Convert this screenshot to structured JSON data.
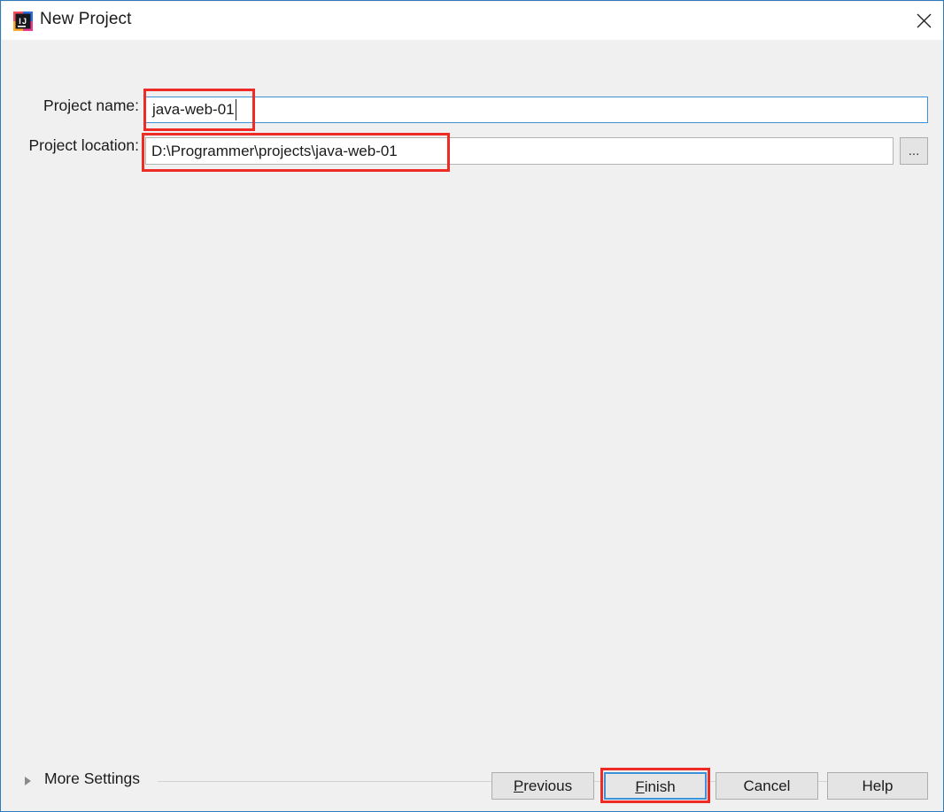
{
  "window": {
    "title": "New Project",
    "icon": "intellij-idea-icon",
    "close_icon": "close-icon"
  },
  "form": {
    "project_name": {
      "label": "Project name:",
      "value": "java-web-01",
      "placeholder": "",
      "focused": true
    },
    "project_location": {
      "label": "Project location:",
      "value": "D:\\Programmer\\projects\\java-web-01",
      "placeholder": "",
      "browse_label": "..."
    }
  },
  "more_settings": {
    "label": "More Settings",
    "expanded": false,
    "arrow_icon": "chevron-right-icon"
  },
  "buttons": {
    "previous": {
      "label": "Previous",
      "mnemonic": "P"
    },
    "finish": {
      "label": "Finish",
      "mnemonic": "F",
      "focused": true
    },
    "cancel": {
      "label": "Cancel"
    },
    "help": {
      "label": "Help"
    }
  },
  "annotations": {
    "color": "#ee2b24",
    "targets": [
      "project-name-value",
      "project-location-value",
      "finish-button"
    ]
  },
  "colors": {
    "window_border": "#2f7bbd",
    "panel_background": "#f0f0f0",
    "titlebar_background": "#ffffff",
    "focus_border": "#3c92d8",
    "annotation_red": "#ee2b24",
    "button_face": "#e4e4e4"
  }
}
